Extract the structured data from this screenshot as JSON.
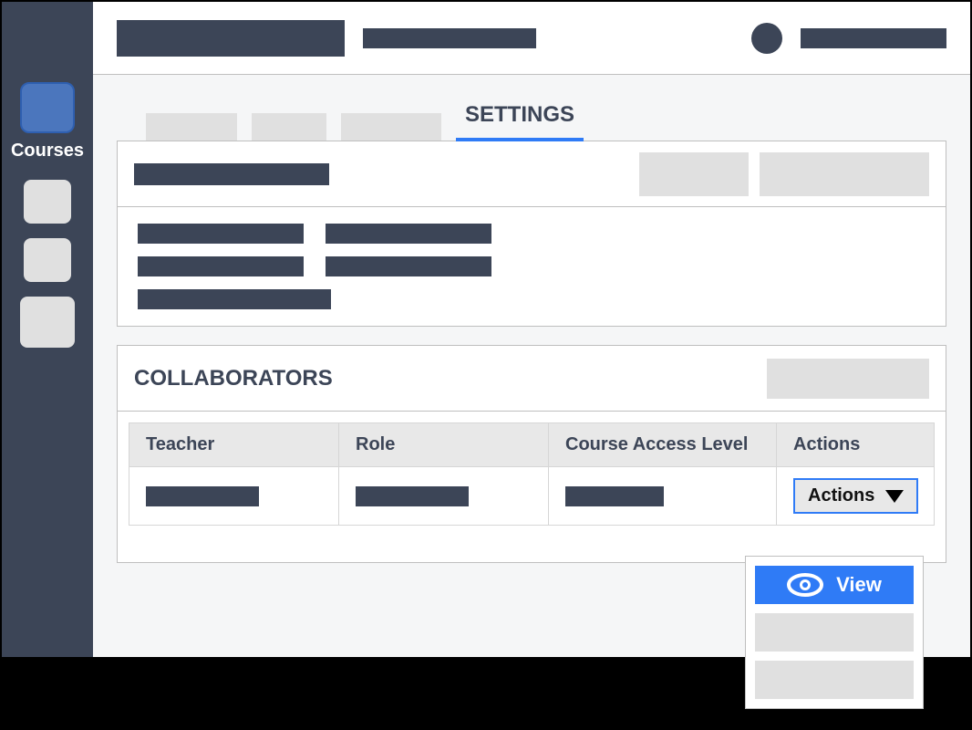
{
  "sidebar": {
    "active_label": "Courses"
  },
  "tabs": {
    "active_label": "SETTINGS"
  },
  "collaborators": {
    "title": "COLLABORATORS",
    "columns": {
      "teacher": "Teacher",
      "role": "Role",
      "access": "Course Access Level",
      "actions": "Actions"
    },
    "row": {
      "actions_button": "Actions"
    }
  },
  "dropdown": {
    "view_label": "View"
  }
}
